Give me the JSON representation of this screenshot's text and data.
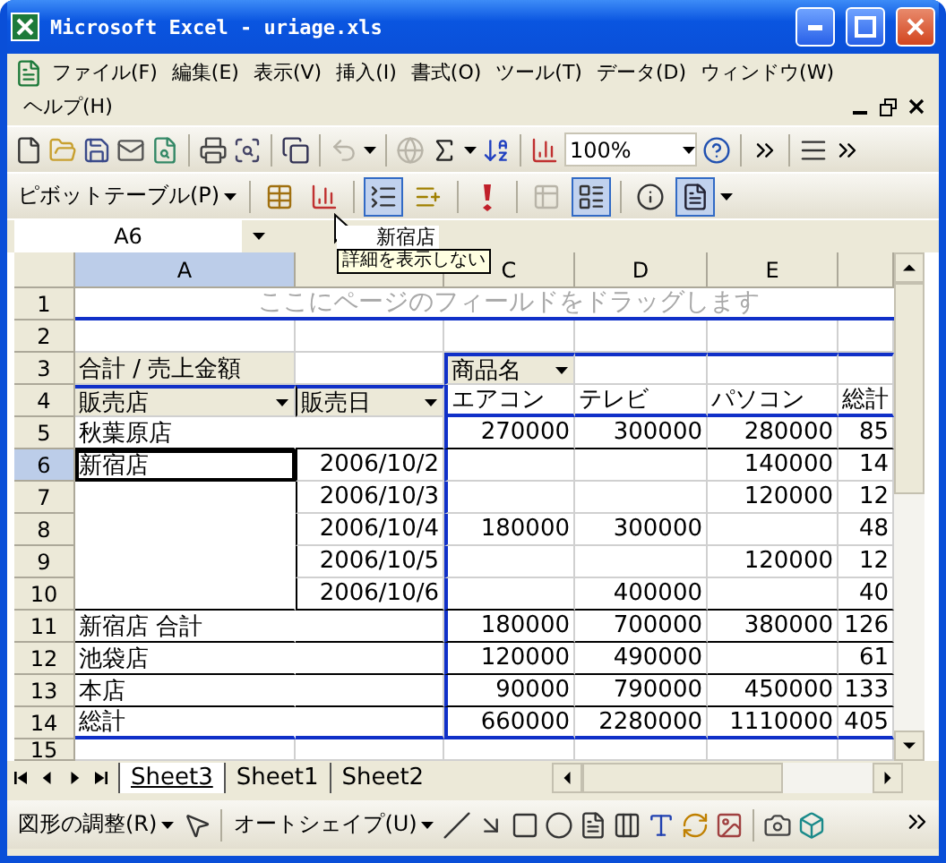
{
  "window": {
    "title": "Microsoft Excel - uriage.xls"
  },
  "menu": [
    "ファイル(F)",
    "編集(E)",
    "表示(V)",
    "挿入(I)",
    "書式(O)",
    "ツール(T)",
    "データ(D)",
    "ウィンドウ(W)",
    "ヘルプ(H)"
  ],
  "standard_toolbar": [
    {
      "kind": "new",
      "disabled": false
    },
    {
      "kind": "open",
      "disabled": false
    },
    {
      "kind": "save",
      "disabled": false
    },
    {
      "kind": "mail",
      "disabled": false
    },
    {
      "kind": "permission",
      "disabled": false
    },
    {
      "kind": "sep"
    },
    {
      "kind": "print",
      "disabled": false
    },
    {
      "kind": "preview",
      "disabled": false
    },
    {
      "kind": "sep"
    },
    {
      "kind": "copy",
      "disabled": false
    },
    {
      "kind": "sep"
    },
    {
      "kind": "undo",
      "disabled": true
    },
    {
      "kind": "sep"
    },
    {
      "kind": "hyperlink",
      "disabled": true
    },
    {
      "kind": "sum",
      "disabled": false
    },
    {
      "kind": "sort",
      "disabled": false
    },
    {
      "kind": "sep"
    },
    {
      "kind": "chart",
      "disabled": false
    },
    {
      "kind": "zoom",
      "value": "100%"
    },
    {
      "kind": "help",
      "disabled": false
    }
  ],
  "pivot_toolbar": {
    "menu": "ピボットテーブル(P)",
    "buttons": [
      {
        "kind": "sep"
      },
      {
        "kind": "format",
        "pressed": false,
        "disabled": false
      },
      {
        "kind": "chart",
        "pressed": false,
        "disabled": false
      },
      {
        "kind": "sep"
      },
      {
        "kind": "hide_detail",
        "pressed": true,
        "disabled": false
      },
      {
        "kind": "show_detail",
        "pressed": false,
        "disabled": false
      },
      {
        "kind": "sep"
      },
      {
        "kind": "refresh",
        "pressed": false,
        "disabled": false
      },
      {
        "kind": "sep"
      },
      {
        "kind": "grand_totals",
        "pressed": false,
        "disabled": true
      },
      {
        "kind": "field_settings",
        "pressed": true,
        "disabled": false
      },
      {
        "kind": "sep"
      },
      {
        "kind": "info",
        "pressed": false,
        "disabled": false
      },
      {
        "kind": "field_list",
        "pressed": true,
        "disabled": false
      }
    ]
  },
  "name_box": "A6",
  "tooltip": {
    "drag_label": "新宿店",
    "text": "詳細を表示しない"
  },
  "columns": [
    {
      "label": "A",
      "selected": true
    },
    {
      "selected": false
    },
    {
      "label": "C",
      "selected": false
    },
    {
      "label": "D",
      "selected": false
    },
    {
      "label": "E",
      "selected": false
    }
  ],
  "rows": [
    {
      "number": "1",
      "selected": false,
      "kind": "page_drop",
      "banner": "ここにページのフィールドをドラッグします"
    },
    {
      "number": "2",
      "selected": false,
      "kind": "blank"
    },
    {
      "number": "3",
      "selected": false,
      "kind": "data_header",
      "cells": [
        {
          "text": "合計 / 売上金額",
          "kind": "field_label"
        },
        "",
        {
          "text": "商品名",
          "kind": "field_button"
        },
        "",
        "",
        ""
      ]
    },
    {
      "number": "4",
      "selected": false,
      "kind": "field_header",
      "cells": [
        {
          "text": "販売店",
          "kind": "field_button"
        },
        {
          "text": "販売日",
          "kind": "field_button"
        },
        "エアコン",
        "テレビ",
        "パソコン",
        "総計"
      ]
    },
    {
      "number": "5",
      "selected": false,
      "kind": "item",
      "group_end": true,
      "cells": [
        "秋葉原店",
        "",
        "270000",
        "300000",
        "280000",
        "85"
      ]
    },
    {
      "number": "6",
      "selected": true,
      "kind": "item",
      "group_end": false,
      "cells": [
        {
          "text": "新宿店",
          "active": true
        },
        "2006/10/2",
        "",
        "",
        "140000",
        "14"
      ]
    },
    {
      "number": "7",
      "selected": false,
      "kind": "item",
      "group_end": false,
      "cells": [
        "",
        "2006/10/3",
        "",
        "",
        "120000",
        "12"
      ]
    },
    {
      "number": "8",
      "selected": false,
      "kind": "item",
      "group_end": false,
      "cells": [
        "",
        "2006/10/4",
        "180000",
        "300000",
        "",
        "48"
      ]
    },
    {
      "number": "9",
      "selected": false,
      "kind": "item",
      "group_end": false,
      "cells": [
        "",
        "2006/10/5",
        "",
        "",
        "120000",
        "12"
      ]
    },
    {
      "number": "10",
      "selected": false,
      "kind": "item",
      "group_end": true,
      "cells": [
        "",
        "2006/10/6",
        "",
        "400000",
        "",
        "40"
      ]
    },
    {
      "number": "11",
      "selected": false,
      "kind": "item",
      "group_end": true,
      "cells": [
        "新宿店 合計",
        "",
        "180000",
        "700000",
        "380000",
        "126"
      ]
    },
    {
      "number": "12",
      "selected": false,
      "kind": "item",
      "group_end": true,
      "cells": [
        "池袋店",
        "",
        "120000",
        "490000",
        "",
        "61"
      ]
    },
    {
      "number": "13",
      "selected": false,
      "kind": "item",
      "group_end": true,
      "cells": [
        "本店",
        "",
        "90000",
        "790000",
        "450000",
        "133"
      ]
    },
    {
      "number": "14",
      "selected": false,
      "kind": "grand_total",
      "group_end": true,
      "cells": [
        "総計",
        "",
        "660000",
        "2280000",
        "1110000",
        "405"
      ]
    },
    {
      "number": "15",
      "selected": false,
      "kind": "blank"
    }
  ],
  "sheet_tabs": [
    {
      "label": "Sheet3",
      "selected": true
    },
    {
      "label": "Sheet1",
      "selected": false
    },
    {
      "label": "Sheet2",
      "selected": false
    }
  ],
  "drawing_toolbar": {
    "draw_menu": "図形の調整(R)",
    "autoshape_menu": "オートシェイプ(U)",
    "tools": [
      {
        "kind": "select"
      },
      {
        "kind": "sep"
      },
      {
        "kind": "autoshapes"
      },
      {
        "kind": "line"
      },
      {
        "kind": "arrow"
      },
      {
        "kind": "rectangle"
      },
      {
        "kind": "oval"
      },
      {
        "kind": "textbox"
      },
      {
        "kind": "vertical_textbox"
      },
      {
        "kind": "wordart"
      },
      {
        "kind": "diagram"
      },
      {
        "kind": "clipart"
      },
      {
        "kind": "sep"
      },
      {
        "kind": "camera"
      },
      {
        "kind": "cube"
      }
    ]
  }
}
